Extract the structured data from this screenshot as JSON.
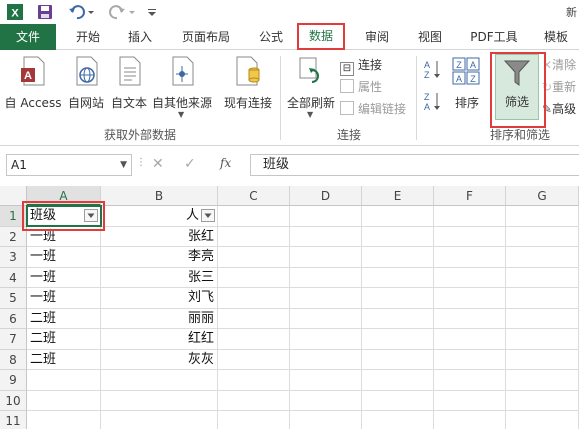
{
  "window": {
    "title_fragment": "新"
  },
  "quick_access": {
    "icons": [
      "excel-logo-icon",
      "save-icon",
      "undo-icon",
      "redo-icon",
      "customize-icon"
    ]
  },
  "tabs": [
    {
      "label": "文件"
    },
    {
      "label": "开始"
    },
    {
      "label": "插入"
    },
    {
      "label": "页面布局"
    },
    {
      "label": "公式"
    },
    {
      "label": "数据"
    },
    {
      "label": "审阅"
    },
    {
      "label": "视图"
    },
    {
      "label": "PDF工具"
    },
    {
      "label": "模板"
    }
  ],
  "active_tab": "数据",
  "ribbon": {
    "external_data": {
      "group_label": "获取外部数据",
      "buttons": [
        {
          "label": "自 Access",
          "icon": "access-icon"
        },
        {
          "label": "自网站",
          "icon": "web-icon"
        },
        {
          "label": "自文本",
          "icon": "text-file-icon"
        },
        {
          "label": "自其他来源",
          "icon": "other-sources-icon"
        }
      ],
      "existing": {
        "label": "现有连接"
      }
    },
    "connections": {
      "group_label": "连接",
      "refresh_all": "全部刷新",
      "connections": "连接",
      "properties": "属性",
      "edit_links": "编辑链接"
    },
    "sort_filter": {
      "group_label": "排序和筛选",
      "sort": "排序",
      "filter": "筛选",
      "clear": "清除",
      "reapply": "重新",
      "advanced": "高级"
    }
  },
  "formula_bar": {
    "name_box": "A1",
    "formula_value": "班级",
    "fx": "fx"
  },
  "grid": {
    "columns": [
      "A",
      "B",
      "C",
      "D",
      "E",
      "F",
      "G"
    ],
    "rows": [
      "1",
      "2",
      "3",
      "4",
      "5",
      "6",
      "7",
      "8",
      "9",
      "10",
      "11"
    ],
    "cells": {
      "A": [
        "班级",
        "一班",
        "一班",
        "一班",
        "一班",
        "二班",
        "二班",
        "二班"
      ],
      "B": [
        "人",
        "张红",
        "李亮",
        "张三",
        "刘飞",
        "丽丽",
        "红红",
        "灰灰"
      ]
    }
  },
  "colors": {
    "accent": "#217346",
    "highlight": "#e03c3c"
  }
}
